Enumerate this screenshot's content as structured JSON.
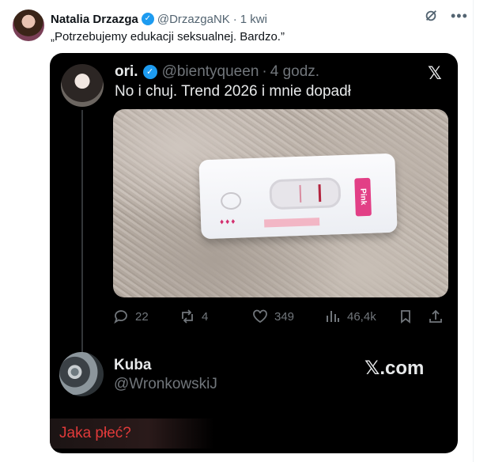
{
  "tweet": {
    "author_name": "Natalia Drzazga",
    "verified_glyph": "✓",
    "handle": "@DrzazgaNK",
    "dot": "·",
    "time": "1 kwi",
    "text": "„Potrzebujemy edukacji seksualnej. Bardzo.”",
    "more_glyph": "•••"
  },
  "quoted": {
    "author_name": "ori.",
    "verified_glyph": "✓",
    "handle": "@bientyqueen",
    "dot": "·",
    "time": "4 godz.",
    "text": "No i chuj. Trend 2026 i mnie dopadł",
    "x_logo": "𝕏",
    "test_label": "Pink",
    "stats": {
      "replies": "22",
      "reposts": "4",
      "likes": "349",
      "views": "46,4k"
    }
  },
  "reply": {
    "author_name": "Kuba",
    "handle": "@WronkowskiJ",
    "site": "𝕏.com",
    "text": "Jaka płeć?"
  },
  "colors": {
    "accent": "#1d9bf0",
    "card_bg": "#000000",
    "reply_text": "#e03a3a",
    "test_pink": "#e23f86"
  },
  "icons": [
    "grok-icon",
    "more-icon",
    "x-logo-icon",
    "reply-icon",
    "repost-icon",
    "like-icon",
    "views-icon",
    "bookmark-icon",
    "share-icon"
  ]
}
